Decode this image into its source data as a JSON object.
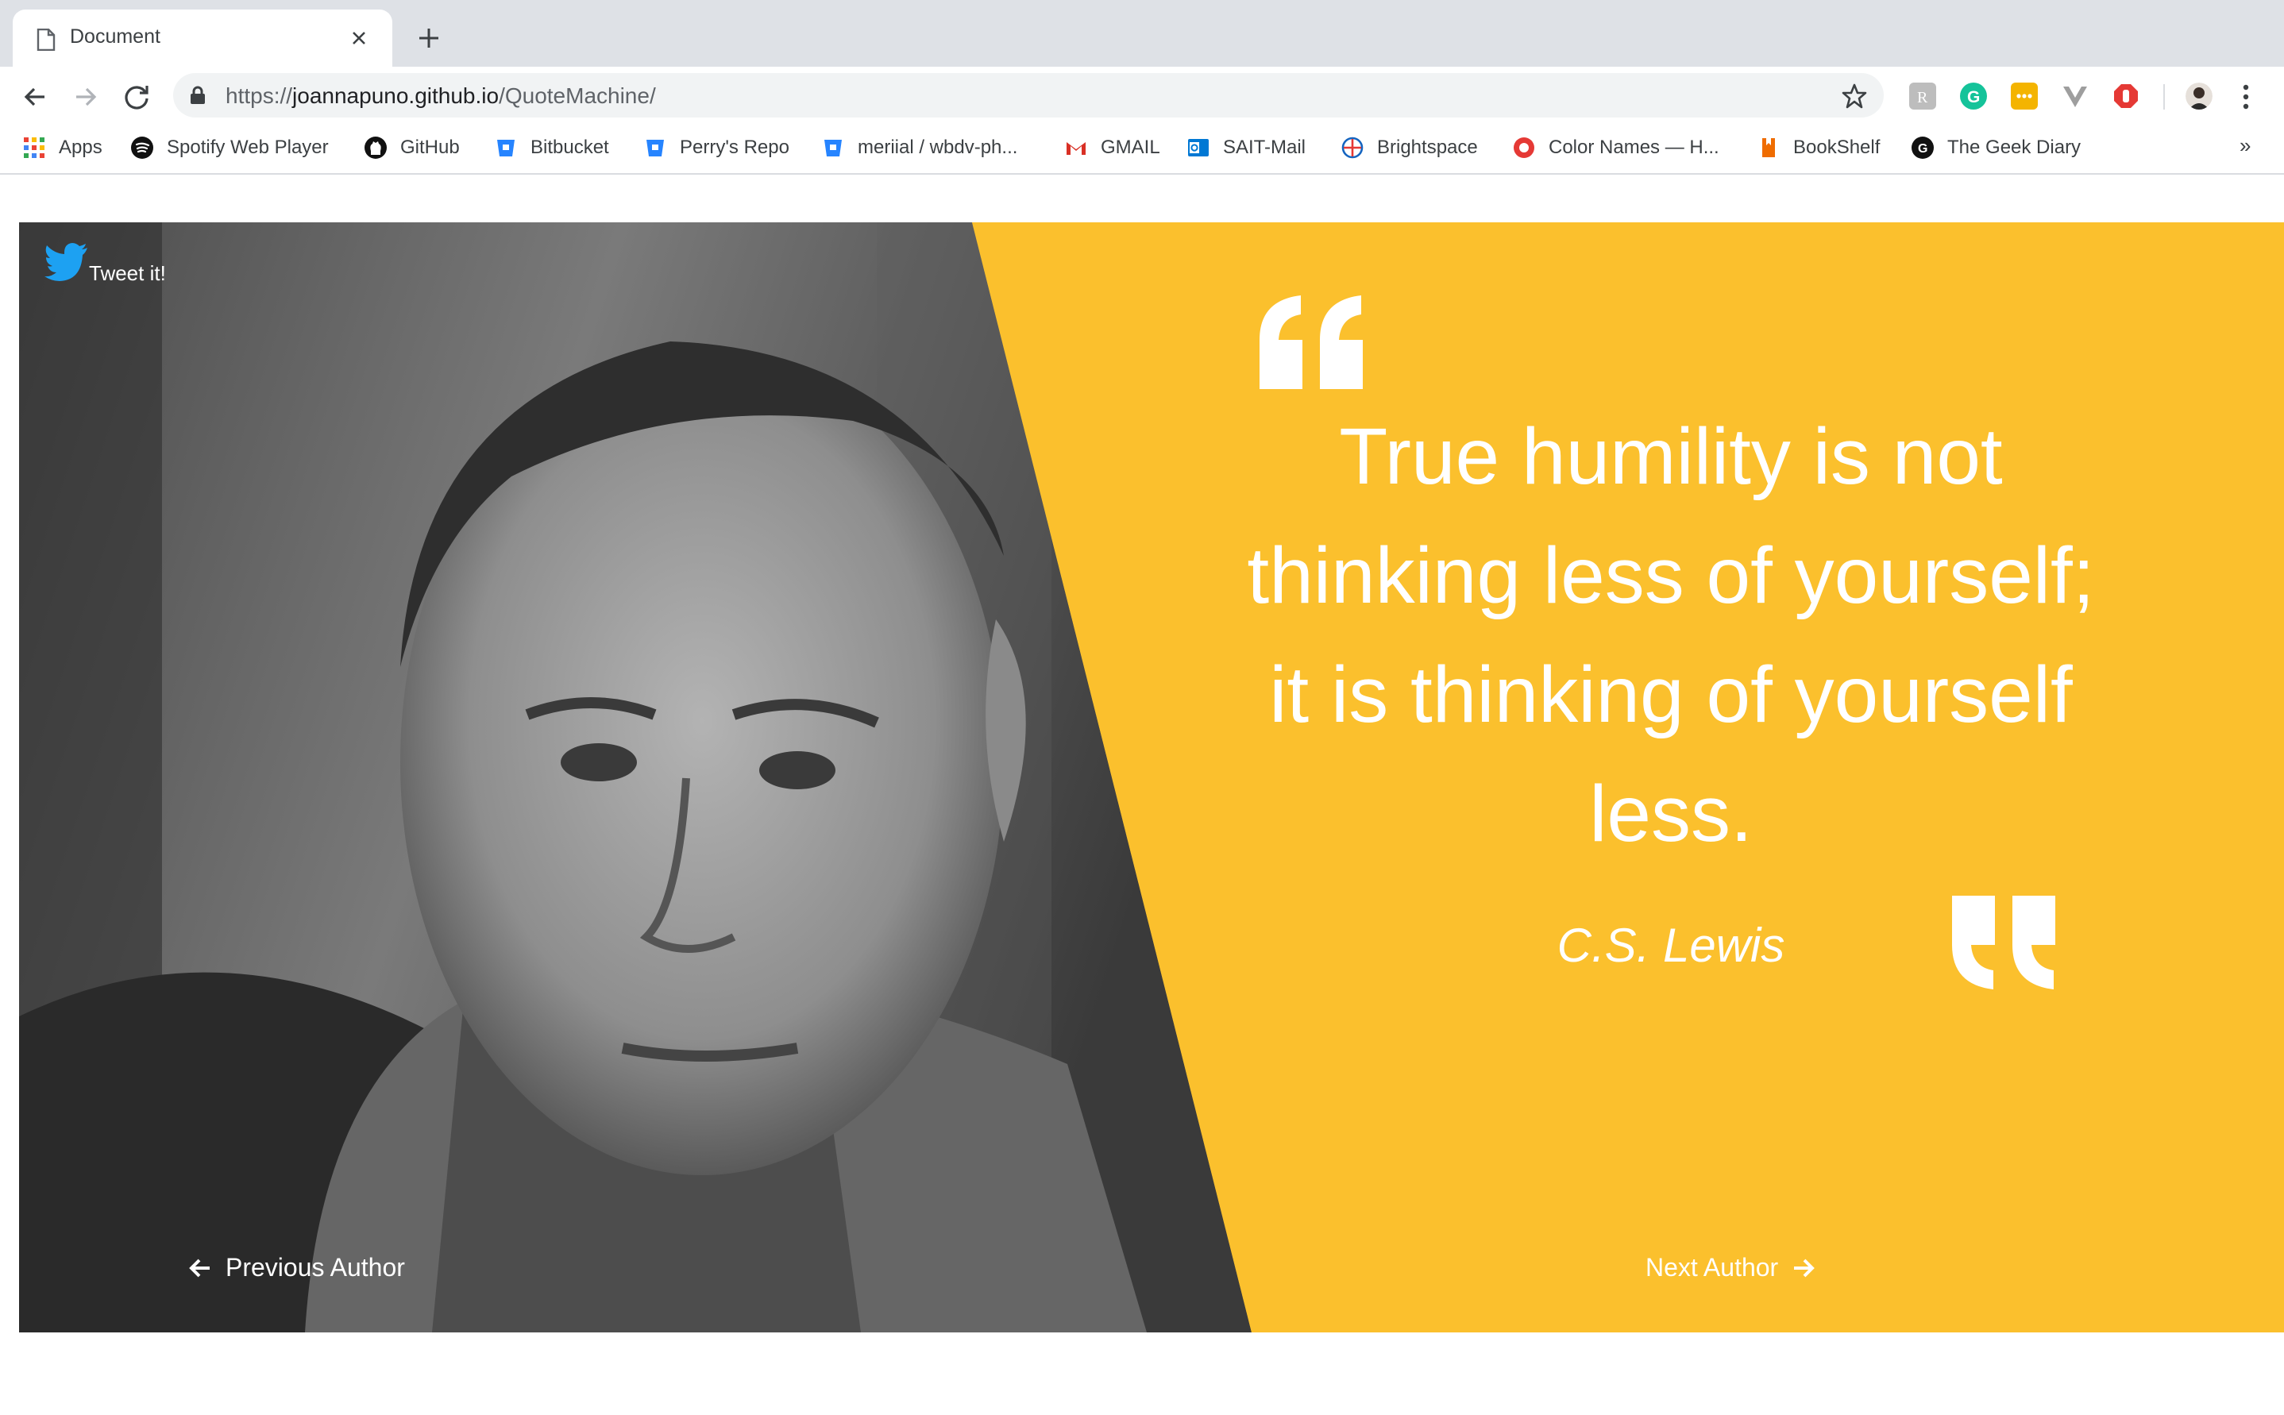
{
  "browser": {
    "tab_title": "Document",
    "url_prefix": "https://",
    "url_host": "joannapuno.github.io",
    "url_path": "/QuoteMachine/",
    "icons": [
      "document-icon",
      "close-icon",
      "plus-icon",
      "back-arrow-icon",
      "forward-arrow-icon",
      "reload-icon",
      "lock-icon",
      "star-icon",
      "kebab-menu-icon"
    ],
    "extensions": [
      {
        "name": "extension-r-icon",
        "color": "#bdbdbd"
      },
      {
        "name": "grammarly-icon",
        "color": "#15c39a"
      },
      {
        "name": "extension-yellow-icon",
        "color": "#f4b400"
      },
      {
        "name": "vue-devtools-icon",
        "color": "#9e9e9e"
      },
      {
        "name": "adblock-icon",
        "color": "#e53935"
      }
    ]
  },
  "bookmarks": [
    {
      "label": "Apps",
      "icon": "apps-grid-icon"
    },
    {
      "label": "Spotify Web Player",
      "icon": "spotify-icon"
    },
    {
      "label": "GitHub",
      "icon": "github-icon"
    },
    {
      "label": "Bitbucket",
      "icon": "bitbucket-icon"
    },
    {
      "label": "Perry's Repo",
      "icon": "bitbucket-icon"
    },
    {
      "label": "meriial / wbdv-ph...",
      "icon": "bitbucket-icon"
    },
    {
      "label": "GMAIL",
      "icon": "gmail-icon"
    },
    {
      "label": "SAIT-Mail",
      "icon": "outlook-icon"
    },
    {
      "label": "Brightspace",
      "icon": "brightspace-icon"
    },
    {
      "label": "Color Names — H...",
      "icon": "color-names-icon"
    },
    {
      "label": "BookShelf",
      "icon": "bookshelf-icon"
    },
    {
      "label": "The Geek Diary",
      "icon": "geek-diary-icon"
    }
  ],
  "bookmarks_more": "»",
  "page": {
    "tweet_label": "Tweet it!",
    "quote": "True humility is not thinking less of yourself; it is thinking of yourself less.",
    "author": "C.S. Lewis",
    "prev_label": "Previous Author",
    "next_label": "Next Author",
    "accent_color": "#fbc02d",
    "twitter_color": "#1da1f2"
  }
}
